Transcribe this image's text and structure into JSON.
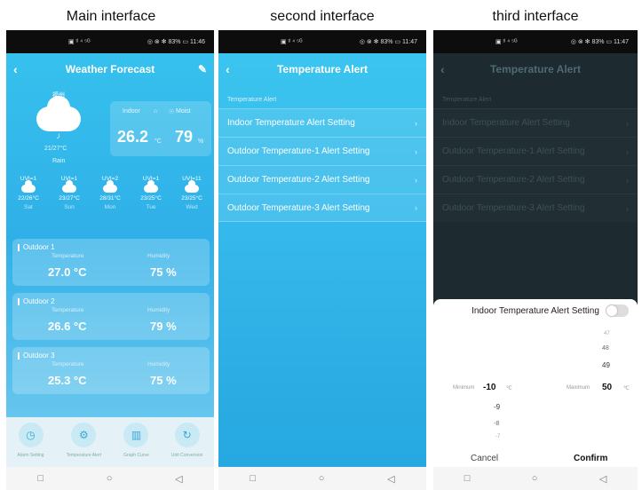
{
  "captions": [
    "Main interface",
    "second interface",
    "third interface"
  ],
  "status": {
    "p1": {
      "left": "▣ ᵗˡ ⁴ ⁵ᴳ",
      "right": "◎ ⊗ ✻ 83% ▭ 11:46"
    },
    "p2": {
      "left": "▣ ᵗˡ ⁴ ⁵ᴳ",
      "right": "◎ ⊗ ✻ 83% ▭ 11:47"
    },
    "p3": {
      "left": "▣ ᵗˡ ⁴ ⁵ᴳ",
      "right": "◎ ⊗ ✻ 83% ▭ 11:47"
    }
  },
  "main": {
    "title": "Weather Forecast",
    "city": "福州",
    "temp_range": "21/27°C",
    "weather": "Rain",
    "indoor_label": "Indoor",
    "moist_label": "Moist",
    "indoor_temp": "26.2",
    "indoor_temp_unit": "°C",
    "moist_value": "79",
    "moist_unit": "%",
    "forecast": [
      {
        "uv": "UVI=1",
        "range": "22/26°C",
        "day": "Sat"
      },
      {
        "uv": "UVI=1",
        "range": "23/27°C",
        "day": "Sun"
      },
      {
        "uv": "UVI=2",
        "range": "28/31°C",
        "day": "Mon"
      },
      {
        "uv": "UVI=1",
        "range": "23/25°C",
        "day": "Tue"
      },
      {
        "uv": "UVI=11",
        "range": "23/25°C",
        "day": "Wed"
      }
    ],
    "outdoors": [
      {
        "name": "Outdoor 1",
        "temp_label": "Temperature",
        "hum_label": "Humidity",
        "temp": "27.0 °C",
        "hum": "75 %"
      },
      {
        "name": "Outdoor 2",
        "temp_label": "Temperature",
        "hum_label": "Humidity",
        "temp": "26.6 °C",
        "hum": "79 %"
      },
      {
        "name": "Outdoor 3",
        "temp_label": "Temperature",
        "hum_label": "Humidity",
        "temp": "25.3 °C",
        "hum": "75 %"
      }
    ],
    "nav": [
      {
        "label": "Alarm Setting",
        "icon": "stopwatch-icon",
        "glyph": "◷"
      },
      {
        "label": "Temperature Alert",
        "icon": "gear-icon",
        "glyph": "⚙"
      },
      {
        "label": "Graph Curve",
        "icon": "chart-icon",
        "glyph": "▥"
      },
      {
        "label": "Unit Conversion",
        "icon": "refresh-icon",
        "glyph": "↻"
      }
    ]
  },
  "alert": {
    "title": "Temperature Alert",
    "section": "Temperature Alert",
    "items": [
      "Indoor Temperature Alert Setting",
      "Outdoor Temperature-1 Alert Setting",
      "Outdoor Temperature-2 Alert Setting",
      "Outdoor Temperature-3 Alert Setting"
    ]
  },
  "sheet": {
    "title": "Indoor Temperature Alert Setting",
    "toggle_on": false,
    "min_label": "Minimum",
    "max_label": "Maximum",
    "unit": "℃",
    "max_above": [
      "47",
      "48",
      "49"
    ],
    "max_value": "50",
    "min_value": "-10",
    "min_below": [
      "-9",
      "-8",
      "-7"
    ],
    "cancel": "Cancel",
    "confirm": "Confirm"
  },
  "sysnav": {
    "square": "□",
    "circle": "○",
    "back": "◁"
  },
  "colors": {
    "accent": "#2fb0e8",
    "dark_overlay": "#1d2a2f"
  }
}
